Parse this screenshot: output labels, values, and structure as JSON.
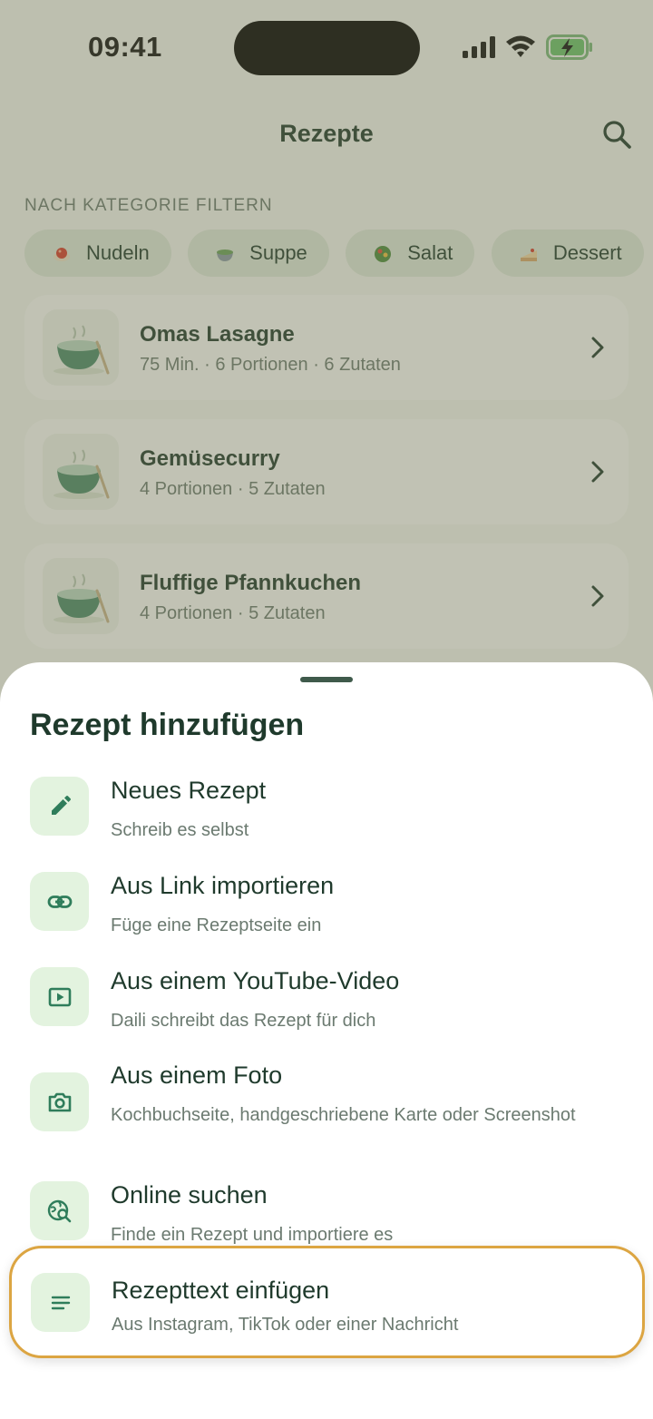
{
  "status_bar": {
    "time": "09:41"
  },
  "header": {
    "title": "Rezepte"
  },
  "filters": {
    "heading": "NACH KATEGORIE FILTERN",
    "chips": [
      {
        "label": "Nudeln",
        "icon": "pasta-emoji-icon"
      },
      {
        "label": "Suppe",
        "icon": "soup-emoji-icon"
      },
      {
        "label": "Salat",
        "icon": "salad-emoji-icon"
      },
      {
        "label": "Dessert",
        "icon": "cake-emoji-icon"
      }
    ]
  },
  "recipes": [
    {
      "name": "Omas Lasagne",
      "meta": "75 Min. · 6 Portionen · 6 Zutaten"
    },
    {
      "name": "Gemüsecurry",
      "meta": "4 Portionen · 5 Zutaten"
    },
    {
      "name": "Fluffige Pfannkuchen",
      "meta": "4 Portionen · 5 Zutaten"
    }
  ],
  "sheet": {
    "title": "Rezept hinzufügen",
    "options": [
      {
        "title": "Neues Rezept",
        "subtitle": "Schreib es selbst",
        "icon": "pencil-icon"
      },
      {
        "title": "Aus Link importieren",
        "subtitle": "Füge eine Rezeptseite ein",
        "icon": "link-icon"
      },
      {
        "title": "Aus einem YouTube-Video",
        "subtitle": "Daili schreibt das Rezept für dich",
        "icon": "video-play-icon"
      },
      {
        "title": "Aus einem Foto",
        "subtitle": "Kochbuchseite, handgeschriebene Karte oder Screenshot",
        "icon": "camera-icon"
      },
      {
        "title": "Online suchen",
        "subtitle": "Finde ein Rezept und importiere es",
        "icon": "globe-search-icon"
      },
      {
        "title": "Rezepttext einfügen",
        "subtitle": "Aus Instagram, TikTok oder einer Nachricht",
        "icon": "text-lines-icon"
      }
    ]
  },
  "colors": {
    "accent_green": "#2f7d5b",
    "icon_bg": "#e3f3df",
    "highlight_border": "#dca542",
    "text_dark": "#1f3a2c"
  }
}
